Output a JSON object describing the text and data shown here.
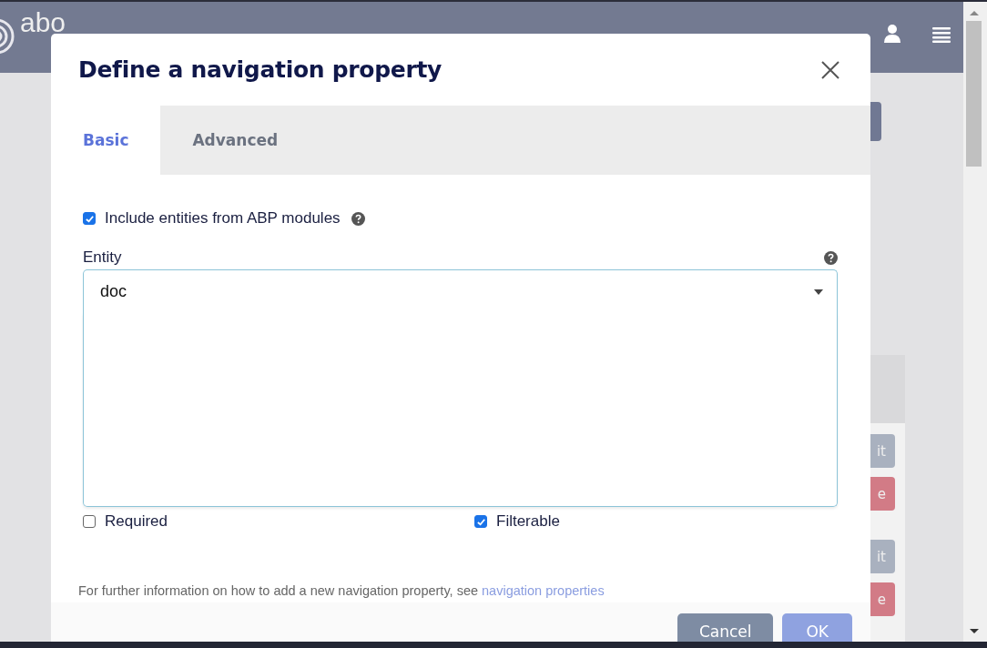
{
  "app_header": {
    "logo_text": "abo"
  },
  "background_buttons": [
    {
      "kind": "edit",
      "label": "it"
    },
    {
      "kind": "delete",
      "label": "e"
    },
    {
      "kind": "edit",
      "label": "it"
    },
    {
      "kind": "delete",
      "label": "e"
    }
  ],
  "dialog": {
    "title": "Define a navigation property",
    "tabs": [
      {
        "label": "Basic",
        "selected": true
      },
      {
        "label": "Advanced",
        "selected": false
      }
    ],
    "include_modules": {
      "label": "Include entities from ABP modules",
      "checked": true
    },
    "entity": {
      "label": "Entity",
      "value": "doc",
      "expanded": true
    },
    "options": [
      {
        "label": "Required",
        "checked": false
      },
      {
        "label": "Filterable",
        "checked": true
      }
    ],
    "info": {
      "text": "For further information on how to add a new navigation property, see",
      "link": "navigation properties"
    },
    "buttons": [
      {
        "kind": "secondary",
        "label": "Cancel"
      },
      {
        "kind": "primary",
        "label": "OK"
      }
    ]
  }
}
